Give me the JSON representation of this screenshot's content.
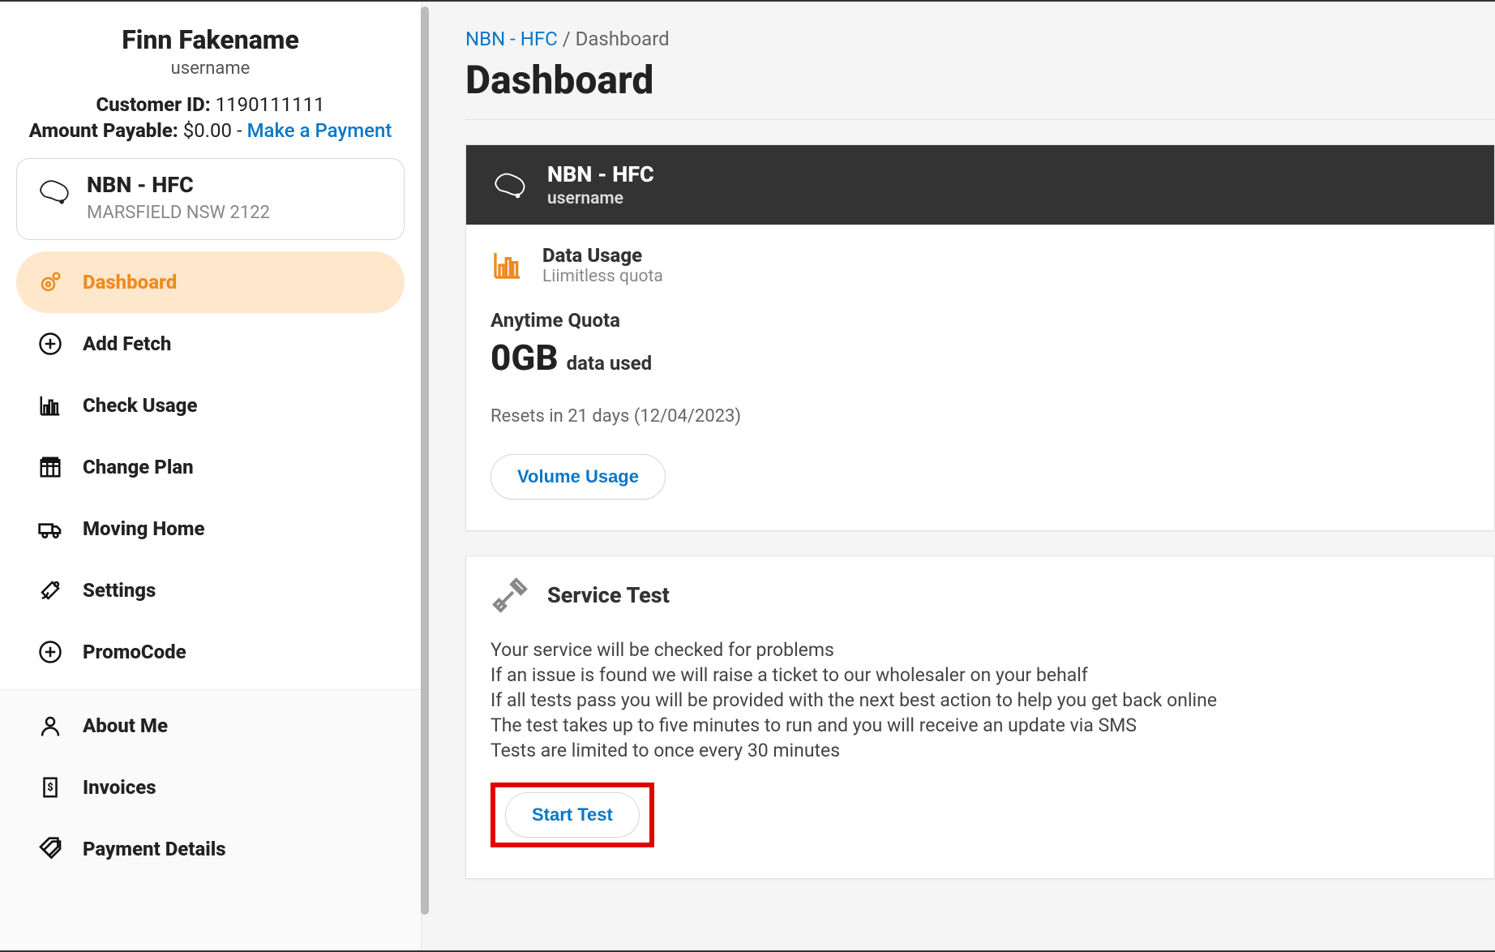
{
  "user": {
    "name": "Finn Fakename",
    "login": "username",
    "customer_id_label": "Customer ID:",
    "customer_id": "1190111111",
    "amount_label": "Amount Payable:",
    "amount_value": "$0.00",
    "amount_separator": " - ",
    "make_payment": "Make a Payment"
  },
  "service_card": {
    "name": "NBN - HFC",
    "location": "MARSFIELD NSW 2122"
  },
  "nav": {
    "items": [
      {
        "label": "Dashboard",
        "active": true
      },
      {
        "label": "Add Fetch"
      },
      {
        "label": "Check Usage"
      },
      {
        "label": "Change Plan"
      },
      {
        "label": "Moving Home"
      },
      {
        "label": "Settings"
      },
      {
        "label": "PromoCode"
      }
    ],
    "secondary": [
      {
        "label": "About Me"
      },
      {
        "label": "Invoices"
      },
      {
        "label": "Payment Details"
      }
    ]
  },
  "breadcrumb": {
    "link": "NBN - HFC",
    "sep": " / ",
    "current": "Dashboard"
  },
  "page_title": "Dashboard",
  "service_header": {
    "title": "NBN - HFC",
    "subtitle": "username"
  },
  "data_usage": {
    "title": "Data Usage",
    "subtitle": "Liimitless quota",
    "quota_label": "Anytime Quota",
    "value": "0GB",
    "value_suffix": "data used",
    "reset_text": "Resets in 21 days (12/04/2023)",
    "volume_btn": "Volume Usage"
  },
  "service_test": {
    "title": "Service Test",
    "line1": "Your service will be checked for problems",
    "line2": "If an issue is found we will raise a ticket to our wholesaler on your behalf",
    "line3": "If all tests pass you will be provided with the next best action to help you get back online",
    "line4": "The test takes up to five minutes to run and you will receive an update via SMS",
    "line5": "Tests are limited to once every 30 minutes",
    "start_btn": "Start Test"
  }
}
